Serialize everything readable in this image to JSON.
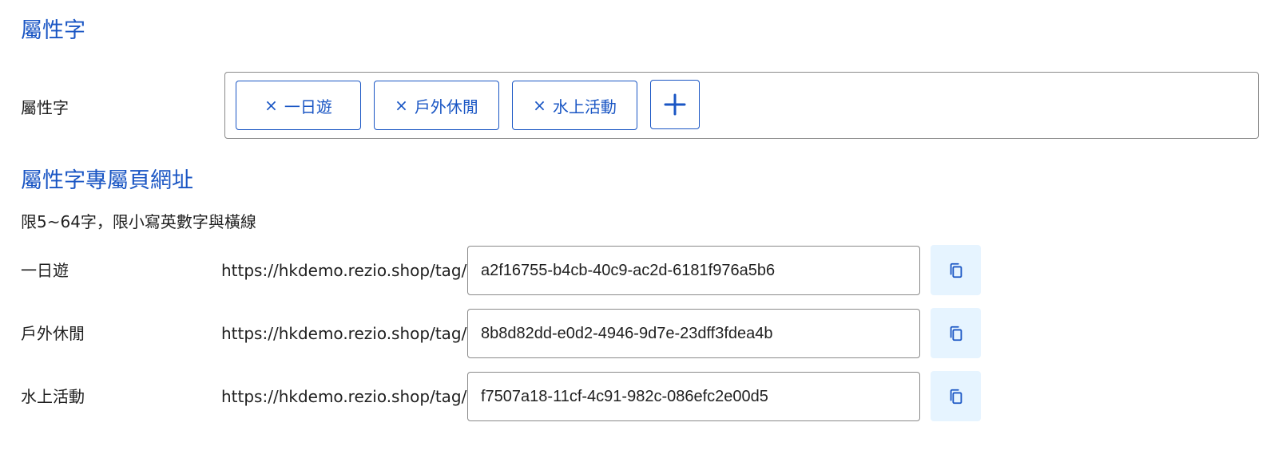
{
  "tags_section": {
    "title": "屬性字",
    "field_label": "屬性字",
    "tags": [
      {
        "label": "一日遊",
        "remove_symbol": "×"
      },
      {
        "label": "戶外休閒",
        "remove_symbol": "×"
      },
      {
        "label": "水上活動",
        "remove_symbol": "×"
      }
    ],
    "add_icon": "plus-icon"
  },
  "url_section": {
    "title": "屬性字專屬頁網址",
    "hint": "限5~64字，限小寫英數字與橫線",
    "rows": [
      {
        "label": "一日遊",
        "prefix": "https://hkdemo.rezio.shop/tag/",
        "slug": "a2f16755-b4cb-40c9-ac2d-6181f976a5b6",
        "copy_icon": "copy-icon"
      },
      {
        "label": "戶外休閒",
        "prefix": "https://hkdemo.rezio.shop/tag/",
        "slug": "8b8d82dd-e0d2-4946-9d7e-23dff3fdea4b",
        "copy_icon": "copy-icon"
      },
      {
        "label": "水上活動",
        "prefix": "https://hkdemo.rezio.shop/tag/",
        "slug": "f7507a18-11cf-4c91-982c-086efc2e00d5",
        "copy_icon": "copy-icon"
      }
    ]
  },
  "colors": {
    "accent": "#1a56c4",
    "border": "#8a8a8a",
    "copy_button_bg": "#e6f4ff",
    "text": "#1f1f1f"
  }
}
